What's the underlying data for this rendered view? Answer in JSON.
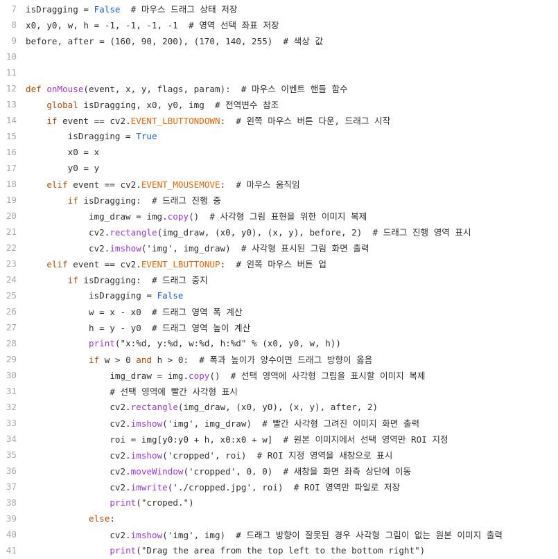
{
  "editor": {
    "lines": [
      {
        "n": "7",
        "t": [
          [
            "tx",
            "isDragging "
          ],
          [
            "tx",
            "= "
          ],
          [
            "bl",
            "False"
          ],
          [
            "cm",
            "  # 마우스 드래그 상태 저장"
          ]
        ]
      },
      {
        "n": "8",
        "t": [
          [
            "tx",
            "x0, y0, w, h = -1, -1, -1, -1  # 영역 선택 좌표 저장"
          ]
        ]
      },
      {
        "n": "9",
        "t": [
          [
            "tx",
            "before, after = (160, 90, 200), (170, 140, 255)  # 색상 값"
          ]
        ]
      },
      {
        "n": "10",
        "t": []
      },
      {
        "n": "11",
        "t": []
      },
      {
        "n": "12",
        "t": [
          [
            "kw",
            "def "
          ],
          [
            "fn",
            "onMouse"
          ],
          [
            "tx",
            "(event, x, y, flags, param):  # 마우스 이벤트 핸들 함수"
          ]
        ]
      },
      {
        "n": "13",
        "t": [
          [
            "tx",
            "    "
          ],
          [
            "kw",
            "global "
          ],
          [
            "tx",
            "isDragging, x0, y0, img  # 전역변수 참조"
          ]
        ]
      },
      {
        "n": "14",
        "t": [
          [
            "tx",
            "    "
          ],
          [
            "kw",
            "if "
          ],
          [
            "tx",
            "event == cv2."
          ],
          [
            "cst",
            "EVENT_LBUTTONDOWN"
          ],
          [
            "tx",
            ":  # 왼쪽 마우스 버튼 다운, 드래그 시작"
          ]
        ]
      },
      {
        "n": "15",
        "t": [
          [
            "tx",
            "        isDragging = "
          ],
          [
            "bl",
            "True"
          ]
        ]
      },
      {
        "n": "16",
        "t": [
          [
            "tx",
            "        x0 = x"
          ]
        ]
      },
      {
        "n": "17",
        "t": [
          [
            "tx",
            "        y0 = y"
          ]
        ]
      },
      {
        "n": "18",
        "t": [
          [
            "tx",
            "    "
          ],
          [
            "kw",
            "elif "
          ],
          [
            "tx",
            "event == cv2."
          ],
          [
            "cst",
            "EVENT_MOUSEMOVE"
          ],
          [
            "tx",
            ":  # 마우스 움직임"
          ]
        ]
      },
      {
        "n": "19",
        "t": [
          [
            "tx",
            "        "
          ],
          [
            "kw",
            "if "
          ],
          [
            "tx",
            "isDragging:  # 드래그 진행 중"
          ]
        ]
      },
      {
        "n": "20",
        "t": [
          [
            "tx",
            "            img_draw = img."
          ],
          [
            "fn",
            "copy"
          ],
          [
            "tx",
            "()  # 사각형 그림 표현을 위한 이미지 복제"
          ]
        ]
      },
      {
        "n": "21",
        "t": [
          [
            "tx",
            "            cv2."
          ],
          [
            "fn",
            "rectangle"
          ],
          [
            "tx",
            "(img_draw, (x0, y0), (x, y), before, 2)  # 드래그 진행 영역 표시"
          ]
        ]
      },
      {
        "n": "22",
        "t": [
          [
            "tx",
            "            cv2."
          ],
          [
            "fn",
            "imshow"
          ],
          [
            "tx",
            "('img', img_draw)  # 사각형 표시된 그림 화면 출력"
          ]
        ]
      },
      {
        "n": "23",
        "t": [
          [
            "tx",
            "    "
          ],
          [
            "kw",
            "elif "
          ],
          [
            "tx",
            "event == cv2."
          ],
          [
            "cst",
            "EVENT_LBUTTONUP"
          ],
          [
            "tx",
            ":  # 왼쪽 마우스 버튼 업"
          ]
        ]
      },
      {
        "n": "24",
        "t": [
          [
            "tx",
            "        "
          ],
          [
            "kw",
            "if "
          ],
          [
            "tx",
            "isDragging:  # 드래그 중지"
          ]
        ]
      },
      {
        "n": "25",
        "t": [
          [
            "tx",
            "            isDragging = "
          ],
          [
            "bl",
            "False"
          ]
        ]
      },
      {
        "n": "26",
        "t": [
          [
            "tx",
            "            w = x - x0  # 드래그 영역 폭 계산"
          ]
        ]
      },
      {
        "n": "27",
        "t": [
          [
            "tx",
            "            h = y - y0  # 드래그 영역 높이 계산"
          ]
        ]
      },
      {
        "n": "28",
        "t": [
          [
            "tx",
            "            "
          ],
          [
            "fn",
            "print"
          ],
          [
            "tx",
            "(\"x:%d, y:%d, w:%d, h:%d\" % (x0, y0, w, h))"
          ]
        ]
      },
      {
        "n": "29",
        "t": [
          [
            "tx",
            "            "
          ],
          [
            "kw",
            "if "
          ],
          [
            "tx",
            "w > 0 "
          ],
          [
            "kw",
            "and "
          ],
          [
            "tx",
            "h > 0:  # 폭과 높이가 양수이면 드래그 방향이 옳음"
          ]
        ]
      },
      {
        "n": "30",
        "t": [
          [
            "tx",
            "                img_draw = img."
          ],
          [
            "fn",
            "copy"
          ],
          [
            "tx",
            "()  # 선택 영역에 사각형 그림을 표시할 이미지 복제"
          ]
        ]
      },
      {
        "n": "31",
        "t": [
          [
            "tx",
            "                # 선택 영역에 빨간 사각형 표시"
          ]
        ]
      },
      {
        "n": "32",
        "t": [
          [
            "tx",
            "                cv2."
          ],
          [
            "fn",
            "rectangle"
          ],
          [
            "tx",
            "(img_draw, (x0, y0), (x, y), after, 2)"
          ]
        ]
      },
      {
        "n": "33",
        "t": [
          [
            "tx",
            "                cv2."
          ],
          [
            "fn",
            "imshow"
          ],
          [
            "tx",
            "('img', img_draw)  # 빨간 사각형 그려진 이미지 화면 출력"
          ]
        ]
      },
      {
        "n": "34",
        "t": [
          [
            "tx",
            "                roi = img[y0:y0 + h, x0:x0 + w]  # 원본 이미지에서 선택 영역만 ROI 지정"
          ]
        ]
      },
      {
        "n": "35",
        "t": [
          [
            "tx",
            "                cv2."
          ],
          [
            "fn",
            "imshow"
          ],
          [
            "tx",
            "('cropped', roi)  # ROI 지정 영역을 새창으로 표시"
          ]
        ]
      },
      {
        "n": "36",
        "t": [
          [
            "tx",
            "                cv2."
          ],
          [
            "fn",
            "moveWindow"
          ],
          [
            "tx",
            "('cropped', 0, 0)  # 새창을 화면 좌측 상단에 이동"
          ]
        ]
      },
      {
        "n": "37",
        "t": [
          [
            "tx",
            "                cv2."
          ],
          [
            "fn",
            "imwrite"
          ],
          [
            "tx",
            "('./cropped.jpg', roi)  # ROI 영역만 파일로 저장"
          ]
        ]
      },
      {
        "n": "38",
        "t": [
          [
            "tx",
            "                "
          ],
          [
            "fn",
            "print"
          ],
          [
            "tx",
            "(\"croped.\")"
          ]
        ]
      },
      {
        "n": "39",
        "t": [
          [
            "tx",
            "            "
          ],
          [
            "kw",
            "else"
          ],
          [
            "tx",
            ":"
          ]
        ]
      },
      {
        "n": "40",
        "t": [
          [
            "tx",
            "                cv2."
          ],
          [
            "fn",
            "imshow"
          ],
          [
            "tx",
            "('img', img)  # 드래그 방향이 잘못된 경우 사각형 그림이 없는 원본 이미지 출력"
          ]
        ]
      },
      {
        "n": "41",
        "t": [
          [
            "tx",
            "                "
          ],
          [
            "fn",
            "print"
          ],
          [
            "tx",
            "(\"Drag the area from the top left to the bottom right\")"
          ]
        ]
      }
    ]
  },
  "colors": {
    "background": "#ffffff",
    "line_number": "#a7a7a7",
    "text": "#2e2e2e",
    "keyword": "#b04a0f",
    "builtin_constant": "#1b5fc4",
    "function": "#9a36d6",
    "cv2_constant": "#e2660e"
  }
}
